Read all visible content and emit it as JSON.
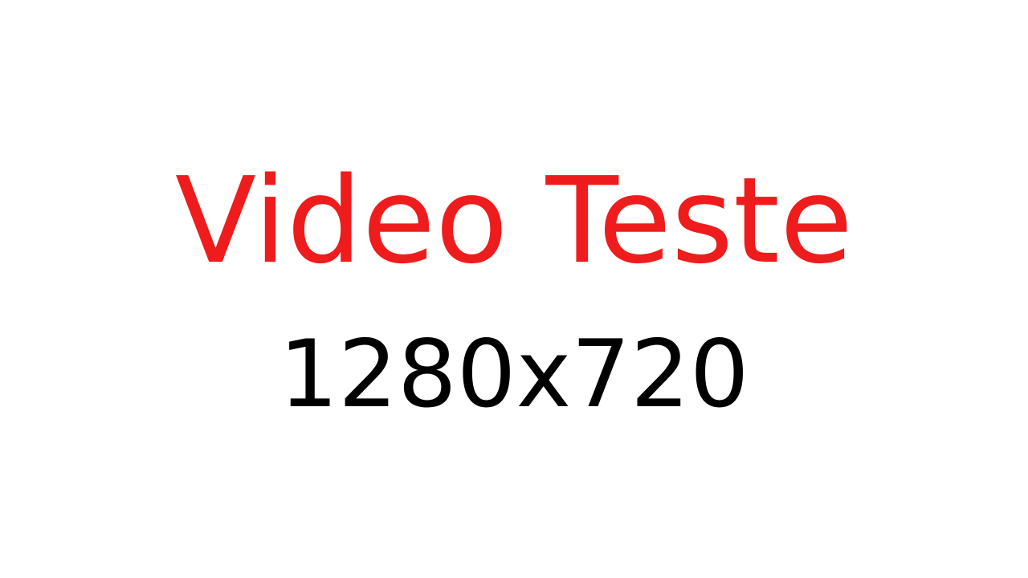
{
  "colors": {
    "background": "#ffffff",
    "title": "#ee1c1c",
    "subtitle": "#000000"
  },
  "test_card": {
    "title": "Video Teste",
    "resolution": "1280x720"
  }
}
